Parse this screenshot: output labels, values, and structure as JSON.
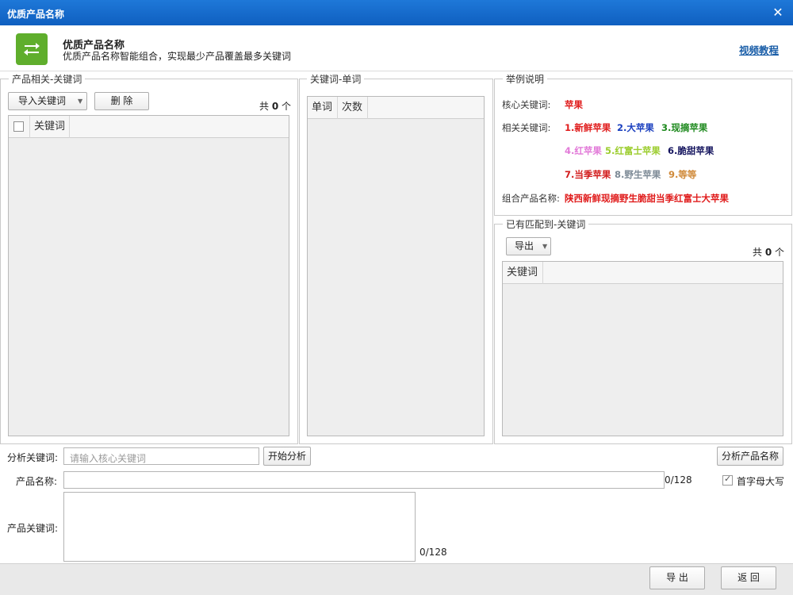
{
  "window": {
    "title": "优质产品名称",
    "close_glyph": "✕"
  },
  "header": {
    "title": "优质产品名称",
    "subtitle": "优质产品名称智能组合，实现最少产品覆盖最多关键词",
    "tutorial_link": "视频教程",
    "logo_icon": "repeat-arrows-icon",
    "accent": "#5fae2c"
  },
  "panel_related": {
    "legend": "产品相关-关键词",
    "import_label": "导入关键词",
    "delete_label": "删 除",
    "count_prefix": "共",
    "count_value": "0",
    "count_suffix": "个",
    "column_keyword": "关键词"
  },
  "panel_words": {
    "legend": "关键词-单词",
    "col_word": "单词",
    "col_count": "次数"
  },
  "panel_example": {
    "legend": "举例说明",
    "core_label": "核心关键词:",
    "core_value": "苹果",
    "related_label": "相关关键词:",
    "items_row1": [
      {
        "text": "1.新鲜苹果",
        "color": "#e01b1b"
      },
      {
        "text": "2.大苹果",
        "color": "#1a3fbf"
      },
      {
        "text": "3.现摘苹果",
        "color": "#1f8a1f"
      }
    ],
    "items_row2": [
      {
        "text": "4.红苹果",
        "color": "#e27ad8"
      },
      {
        "text": "5.红富士苹果",
        "color": "#9ccd2e"
      },
      {
        "text": "6.脆甜苹果",
        "color": "#14145e"
      }
    ],
    "items_row3": [
      {
        "text": "7.当季苹果",
        "color": "#d21b1b"
      },
      {
        "text": "8.野生苹果",
        "color": "#7d8a96"
      },
      {
        "text": "9.等等",
        "color": "#d08a3a"
      }
    ],
    "combined_label": "组合产品名称:",
    "combined_value": "陕西新鲜现摘野生脆甜当季红富士大苹果"
  },
  "panel_matched": {
    "legend": "已有匹配到-关键词",
    "export_label": "导出",
    "count_prefix": "共",
    "count_value": "0",
    "count_suffix": "个",
    "column_keyword": "关键词"
  },
  "analyze": {
    "label": "分析关键词:",
    "placeholder": "请输入核心关键词",
    "start_label": "开始分析",
    "analyze_name_label": "分析产品名称"
  },
  "product_name": {
    "label": "产品名称:",
    "counter": "0/128",
    "capitalize_label": "首字母大写",
    "capitalize_checked": true
  },
  "product_keywords": {
    "label": "产品关键词:",
    "counter": "0/128"
  },
  "footer": {
    "export_label": "导 出",
    "back_label": "返 回"
  }
}
